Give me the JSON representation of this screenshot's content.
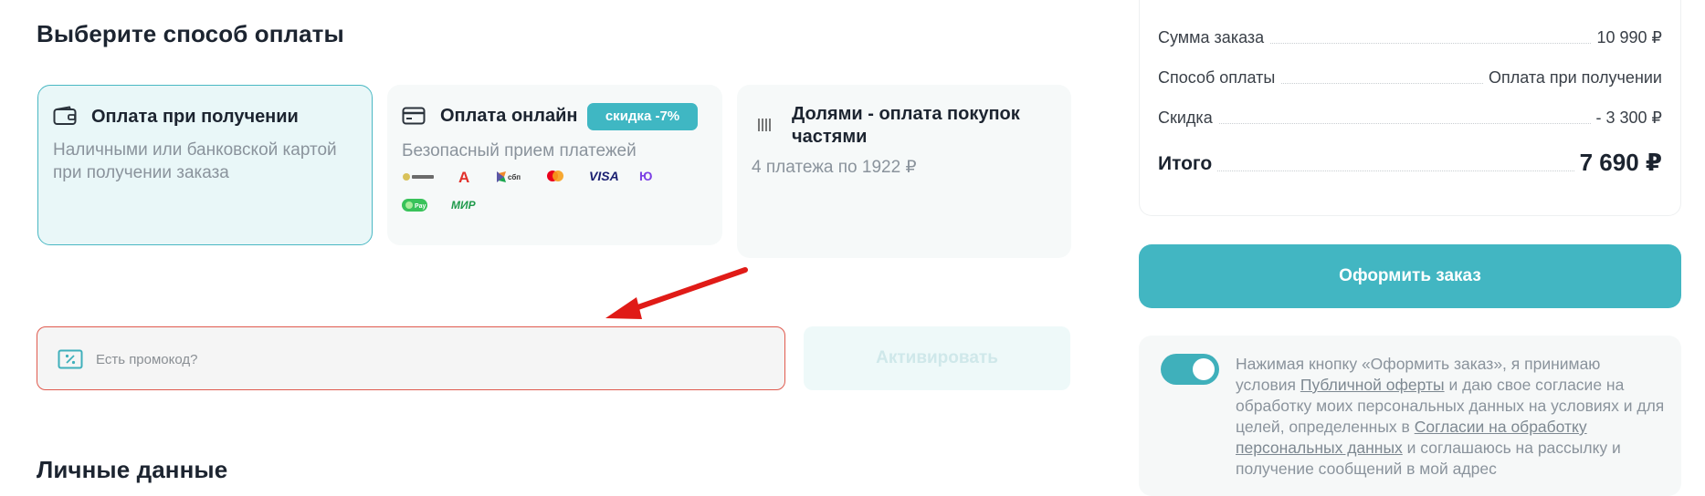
{
  "payment_section": {
    "title": "Выберите способ оплаты",
    "options": [
      {
        "title": "Оплата при получении",
        "description": "Наличными или банковской картой при получении заказа",
        "icon": "wallet-icon",
        "selected": true
      },
      {
        "title": "Оплата онлайн",
        "badge": "скидка -7%",
        "description": "Безопасный прием платежей",
        "icon": "credit-card-icon",
        "payment_logos": [
          "Тинькофф",
          "Альфа-Банк",
          "СБП",
          "Mastercard",
          "VISA",
          "ЮMoney",
          "Pay",
          "МИР"
        ]
      },
      {
        "title": "Долями - оплата покупок частями",
        "description": "4 платежа по 1922 ₽",
        "icon": "dolyami-icon"
      }
    ]
  },
  "promo": {
    "placeholder": "Есть промокод?",
    "activate_label": "Активировать"
  },
  "personal_section": {
    "title": "Личные данные"
  },
  "summary": {
    "rows": [
      {
        "label": "Сумма заказа",
        "value": "10 990 ₽"
      },
      {
        "label": "Способ оплаты",
        "value": "Оплата при получении"
      },
      {
        "label": "Скидка",
        "value": "- 3 300 ₽"
      }
    ],
    "total_label": "Итого",
    "total_value": "7 690 ₽"
  },
  "order_button": "Оформить заказ",
  "consent": {
    "enabled": true,
    "text_1": "Нажимая кнопку «Оформить заказ», я принимаю условия ",
    "link_1": "Публичной оферты",
    "text_2": " и даю свое согласие на обработку моих персональных данных на условиях и для целей, определенных в ",
    "link_2": "Согласии на обработку персональных данных",
    "text_3": " и соглашаюсь на рассылку и получение сообщений в мой адрес"
  },
  "colors": {
    "accent": "#42b6c2",
    "promo_border": "#e05a4e",
    "arrow": "#e01b17"
  }
}
